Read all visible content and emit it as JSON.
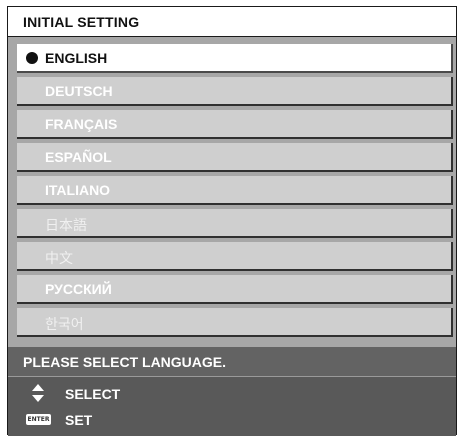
{
  "title": "INITIAL SETTING",
  "languages": [
    {
      "label": "ENGLISH",
      "selected": true
    },
    {
      "label": "DEUTSCH",
      "selected": false
    },
    {
      "label": "FRANÇAIS",
      "selected": false
    },
    {
      "label": "ESPAÑOL",
      "selected": false
    },
    {
      "label": "ITALIANO",
      "selected": false
    },
    {
      "label": "日本語",
      "selected": false
    },
    {
      "label": "中文",
      "selected": false
    },
    {
      "label": "РУССКИЙ",
      "selected": false
    },
    {
      "label": "한국어",
      "selected": false
    }
  ],
  "message": "PLEASE SELECT LANGUAGE.",
  "footer": {
    "select_label": "SELECT",
    "set_label": "SET",
    "enter_key_label": "ENTER",
    "select_icon": "up-down-arrows-icon",
    "set_icon": "enter-key-icon"
  },
  "colors": {
    "selected_row": "#ffffff",
    "unselected_row": "#cfcfcf",
    "footer_bg": "#595959",
    "message_bg": "#636363"
  }
}
